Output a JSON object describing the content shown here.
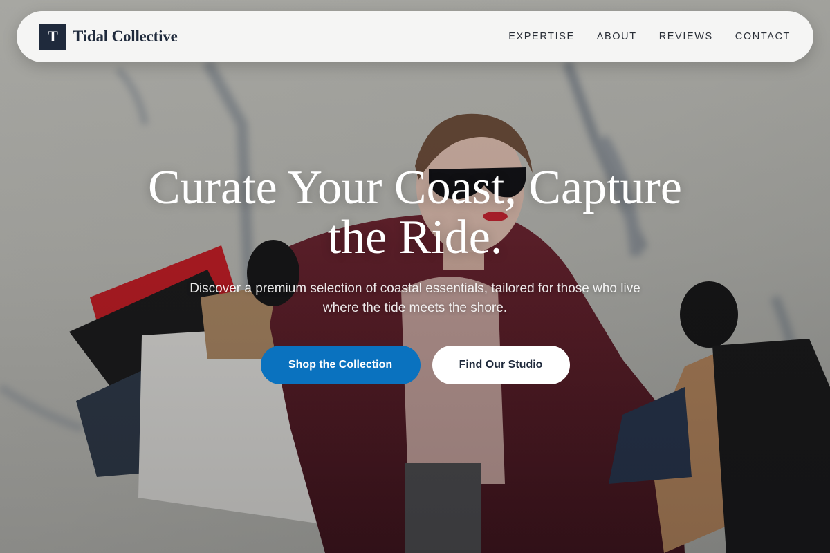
{
  "brand": {
    "mark": "T",
    "name": "Tidal Collective"
  },
  "nav": {
    "items": [
      {
        "label": "EXPERTISE"
      },
      {
        "label": "ABOUT"
      },
      {
        "label": "REVIEWS"
      },
      {
        "label": "CONTACT"
      }
    ]
  },
  "hero": {
    "title": "Curate Your Coast, Capture the Ride.",
    "subtitle": "Discover a premium selection of coastal essentials, tailored for those who live where the tide meets the shore.",
    "primary_cta": "Shop the Collection",
    "secondary_cta": "Find Our Studio",
    "background_image": "woman-with-shopping-bags-photo"
  },
  "colors": {
    "brand_dark": "#1f2a3c",
    "primary_button": "#0a72bf",
    "navbar_bg": "#f8f8f7"
  }
}
